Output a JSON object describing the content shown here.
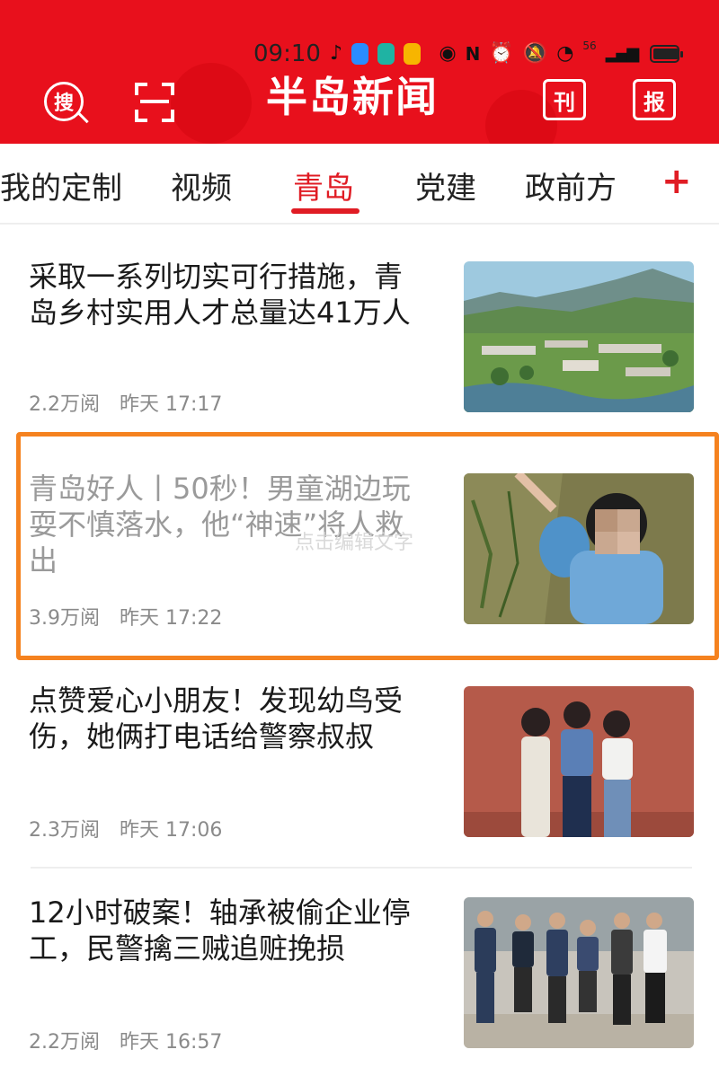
{
  "status_bar": {
    "time": "09:10",
    "app_icons": [
      "tiktok-icon",
      "blue-app-icon",
      "chat-app-icon",
      "weibo-icon"
    ],
    "system_icons": [
      "eye-icon",
      "nfc-icon",
      "alarm-icon",
      "mute-icon",
      "wifi-icon",
      "signal-icon",
      "battery-icon"
    ],
    "network_label": "56"
  },
  "header": {
    "search_label": "搜",
    "logo_text": "半岛新闻",
    "kan_label": "刊",
    "bao_label": "报",
    "brand_color": "#e8101c"
  },
  "tabs": {
    "items": [
      "我的定制",
      "视频",
      "青岛",
      "党建",
      "政前方"
    ],
    "active": "青岛",
    "add_label": "+",
    "accent_color": "#e01c24"
  },
  "news": [
    {
      "title": "采取一系列切实可行措施，青岛乡村实用人才总量达41万人",
      "views": "2.2万阅",
      "time": "昨天 17:17",
      "read": false
    },
    {
      "title": "青岛好人丨50秒！男童湖边玩耍不慎落水，他“神速”将人救出",
      "views": "3.9万阅",
      "time": "昨天 17:22",
      "read": true
    },
    {
      "title": "点赞爱心小朋友！发现幼鸟受伤，她俩打电话给警察叔叔",
      "views": "2.3万阅",
      "time": "昨天 17:06",
      "read": false
    },
    {
      "title": "12小时破案！轴承被偷企业停工，民警擒三贼追赃挽损",
      "views": "2.2万阅",
      "time": "昨天 16:57",
      "read": false
    }
  ],
  "edit_hint": "点击编辑文字",
  "highlight_color": "#f5821f"
}
